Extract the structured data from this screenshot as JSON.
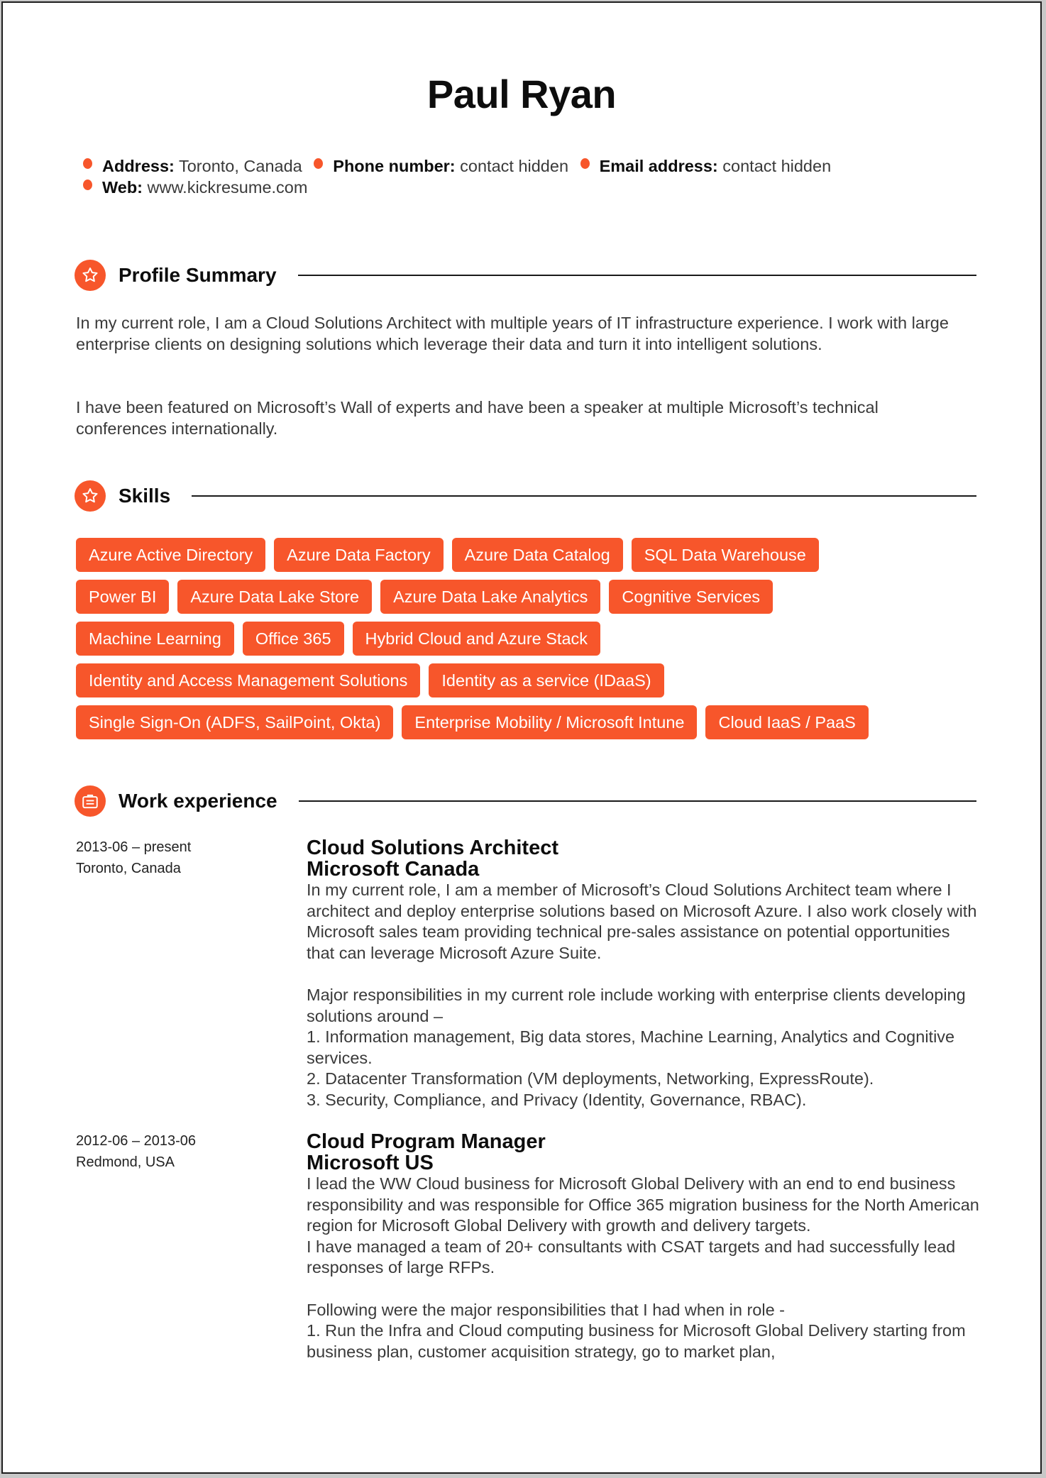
{
  "header": {
    "name": "Paul Ryan",
    "contacts": [
      {
        "label": "Address:",
        "value": "Toronto, Canada"
      },
      {
        "label": "Phone number:",
        "value": "contact hidden"
      },
      {
        "label": "Email address:",
        "value": "contact hidden"
      },
      {
        "label": "Web:",
        "value": "www.kickresume.com"
      }
    ]
  },
  "accent_color": "#f7562b",
  "sections": {
    "profile": {
      "title": "Profile Summary",
      "icon": "star-icon",
      "paragraphs": [
        "In my current role, I am a Cloud Solutions Architect with multiple years of IT infrastructure experience. I work with large enterprise clients on designing solutions which leverage their data and turn it into intelligent solutions.",
        "I have been featured on Microsoft’s Wall of experts and have been a speaker at multiple Microsoft’s technical conferences internationally."
      ]
    },
    "skills": {
      "title": "Skills",
      "icon": "star-icon",
      "rows": [
        [
          "Azure Active Directory",
          "Azure Data Factory",
          "Azure Data Catalog",
          "SQL Data Warehouse"
        ],
        [
          "Power BI",
          "Azure Data Lake Store",
          "Azure Data Lake Analytics",
          "Cognitive Services"
        ],
        [
          "Machine Learning",
          "Office 365",
          "Hybrid Cloud and Azure Stack"
        ],
        [
          "Identity and Access Management Solutions",
          "Identity as a service (IDaaS)"
        ],
        [
          "Single Sign-On (ADFS, SailPoint, Okta)",
          "Enterprise Mobility / Microsoft Intune",
          "Cloud IaaS / PaaS"
        ]
      ]
    },
    "work": {
      "title": "Work experience",
      "icon": "briefcase-icon",
      "jobs": [
        {
          "dates": "2013-06 – present",
          "location": "Toronto, Canada",
          "title": "Cloud Solutions Architect",
          "company": "Microsoft Canada",
          "lines": [
            "In my current role, I am a member of Microsoft’s Cloud Solutions Architect team where I architect and deploy enterprise solutions based on Microsoft Azure. I also work closely with Microsoft sales team providing technical pre-sales assistance on potential opportunities that can leverage Microsoft Azure Suite.",
            "",
            "Major responsibilities in my current role include working with enterprise clients developing solutions around –",
            "1. Information management, Big data stores, Machine Learning, Analytics and Cognitive services.",
            "2. Datacenter Transformation (VM deployments, Networking, ExpressRoute).",
            "3. Security, Compliance, and Privacy (Identity, Governance, RBAC)."
          ]
        },
        {
          "dates": "2012-06 – 2013-06",
          "location": "Redmond, USA",
          "title": "Cloud Program Manager",
          "company": "Microsoft US",
          "lines": [
            "I lead the WW Cloud business for Microsoft Global Delivery with an end to end business responsibility and was responsible for Office 365 migration business for the North American region for Microsoft Global Delivery with growth and delivery targets.",
            "I have managed a team of 20+ consultants with CSAT targets and had successfully lead responses of large RFPs.",
            "",
            "Following were the major responsibilities that I had when in role -",
            "1. Run the Infra and Cloud computing business for Microsoft Global Delivery starting from business plan, customer acquisition strategy, go to market plan,"
          ]
        }
      ]
    }
  }
}
